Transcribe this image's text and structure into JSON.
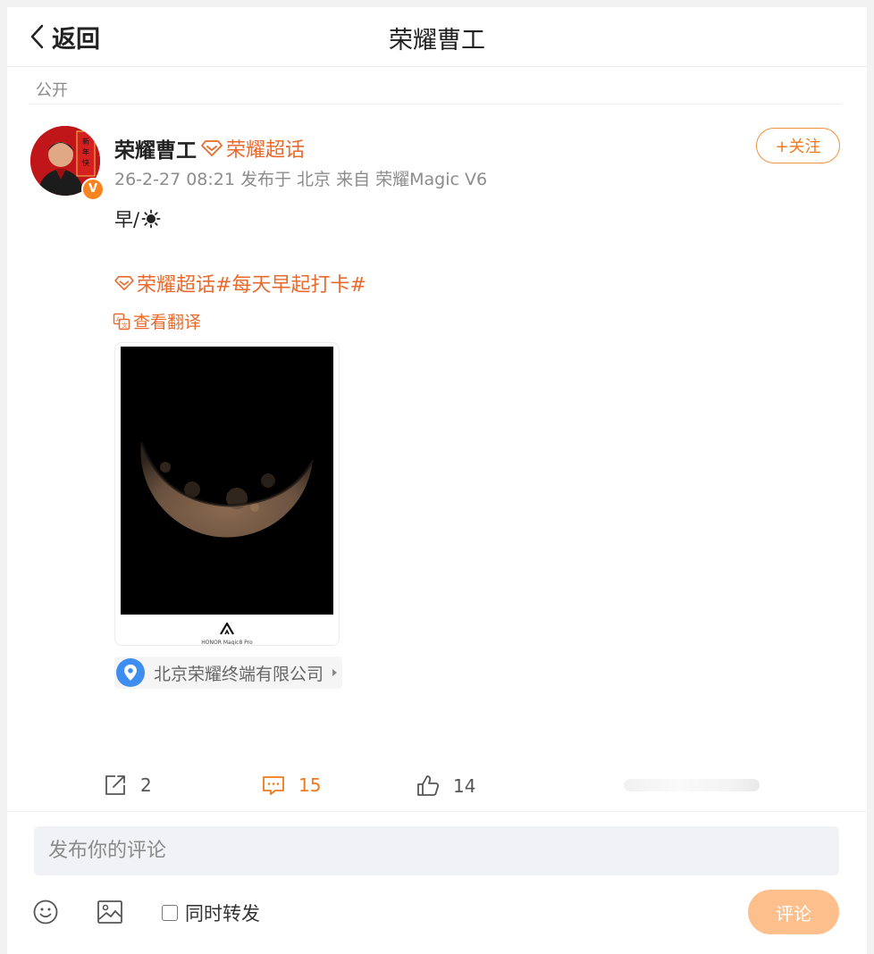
{
  "header": {
    "back_label": "返回",
    "title": "荣耀曹工"
  },
  "visibility": "公开",
  "post": {
    "author_name": "荣耀曹工",
    "verified_badge": "V",
    "supertopic_label": "荣耀超话",
    "meta": "26-2-27 08:21  发布于 北京  来自 荣耀Magic V6",
    "follow_label": "+关注",
    "text": "早/",
    "text_emoji": "sun-icon",
    "tag_supertopic": "荣耀超话",
    "tag_hashtag": "#每天早起打卡#",
    "translate_label": "查看翻译",
    "image_caption": "HONOR Magic8 Pro",
    "location": "北京荣耀终端有限公司"
  },
  "actions": {
    "repost_count": "2",
    "comment_count": "15",
    "like_count": "14"
  },
  "compose": {
    "placeholder": "发布你的评论",
    "repost_label": "同时转发",
    "submit_label": "评论"
  },
  "colors": {
    "accent": "#e86a2c",
    "follow": "#ef7a1c",
    "submit_disabled": "#fdc08c"
  }
}
